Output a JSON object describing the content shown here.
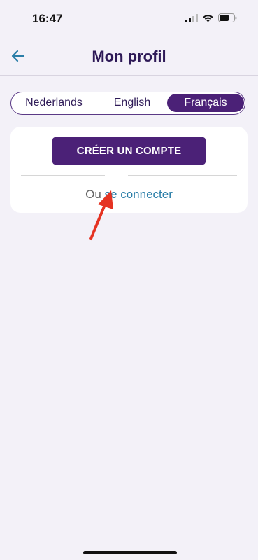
{
  "status_bar": {
    "time": "16:47"
  },
  "header": {
    "title": "Mon profil",
    "back_icon": "arrow-left-icon"
  },
  "language_switch": {
    "options": [
      "Nederlands",
      "English",
      "Français"
    ],
    "selected": "Français"
  },
  "card": {
    "create_account_label": "CRÉER UN COMPTE",
    "login_prefix": "Ou",
    "login_link": "se connecter"
  },
  "colors": {
    "primary": "#4b2177",
    "title": "#2e1a57",
    "link": "#2a7ea8",
    "background": "#f3f1f8",
    "annotation": "#e53322"
  }
}
